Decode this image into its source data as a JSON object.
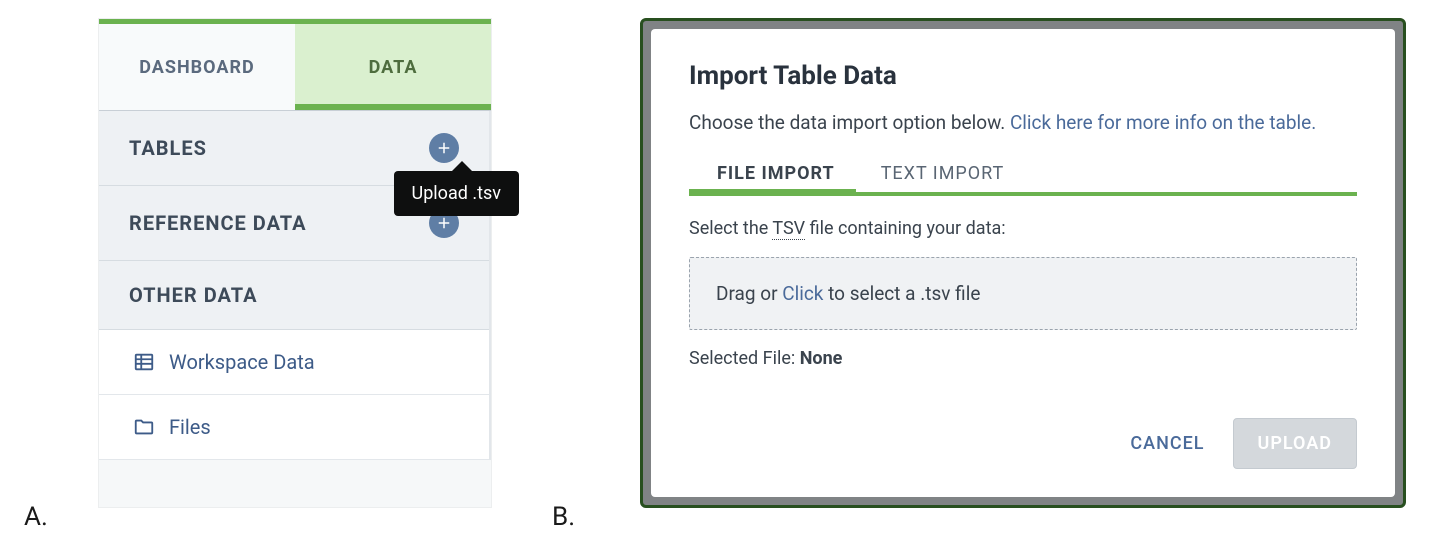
{
  "figure_labels": {
    "a": "A.",
    "b": "B."
  },
  "panel_a": {
    "tabs": {
      "dashboard": "DASHBOARD",
      "data": "DATA"
    },
    "sections": {
      "tables": "TABLES",
      "reference_data": "REFERENCE DATA",
      "other_data": "OTHER DATA"
    },
    "tooltip": "Upload .tsv",
    "other_items": [
      {
        "icon": "table-icon",
        "label": "Workspace Data"
      },
      {
        "icon": "folder-icon",
        "label": "Files"
      }
    ]
  },
  "panel_b": {
    "title": "Import Table Data",
    "description_prefix": "Choose the data import option below. ",
    "description_link": "Click here for more info on the table.",
    "import_tabs": {
      "file": "FILE IMPORT",
      "text": "TEXT IMPORT"
    },
    "select_prefix": "Select the ",
    "select_abbr": "TSV",
    "select_suffix": " file containing your data:",
    "dropzone_prefix": "Drag or ",
    "dropzone_click": "Click",
    "dropzone_suffix": " to select a .tsv file",
    "selected_label": "Selected File: ",
    "selected_value": "None",
    "buttons": {
      "cancel": "CANCEL",
      "upload": "UPLOAD"
    }
  }
}
